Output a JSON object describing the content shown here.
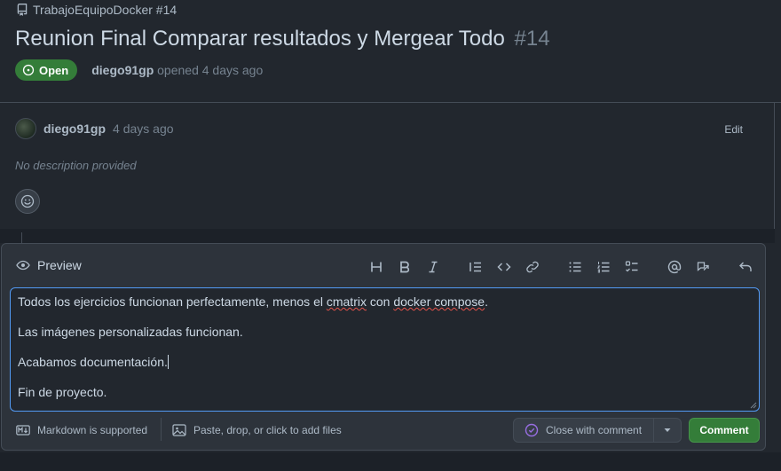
{
  "repo": {
    "name": "TrabajoEquipoDocker #14",
    "icon": "repo-icon"
  },
  "issue": {
    "title": "Reunion Final Comparar resultados y Mergear Todo",
    "number": "#14",
    "state": "Open",
    "author": "diego91gp",
    "opened_text": "opened 4 days ago"
  },
  "comment": {
    "author": "diego91gp",
    "time": "4 days ago",
    "edit_label": "Edit",
    "body": "No description provided"
  },
  "editor": {
    "tab_label": "Preview",
    "toolbar": [
      "heading-icon",
      "bold-icon",
      "italic-icon",
      "quote-icon",
      "code-icon",
      "link-icon",
      "unordered-list-icon",
      "ordered-list-icon",
      "task-list-icon",
      "mention-icon",
      "reference-icon",
      "undo-icon"
    ],
    "lines": [
      {
        "before": "Todos los ejercicios funcionan perfectamente, menos el ",
        "w1": "cmatrix",
        "mid": " con ",
        "w2": "docker compose",
        "after": "."
      },
      {
        "text": "Las imágenes personalizadas funcionan."
      },
      {
        "text": "Acabamos documentación."
      },
      {
        "text": "Fin de proyecto."
      }
    ],
    "markdown_note": "Markdown is supported",
    "attach_note": "Paste, drop, or click to add files",
    "close_label": "Close with comment",
    "comment_label": "Comment"
  },
  "colors": {
    "accent_green": "#347d39",
    "focus_blue": "#539bf5",
    "close_icon_purple": "#986ee2"
  }
}
